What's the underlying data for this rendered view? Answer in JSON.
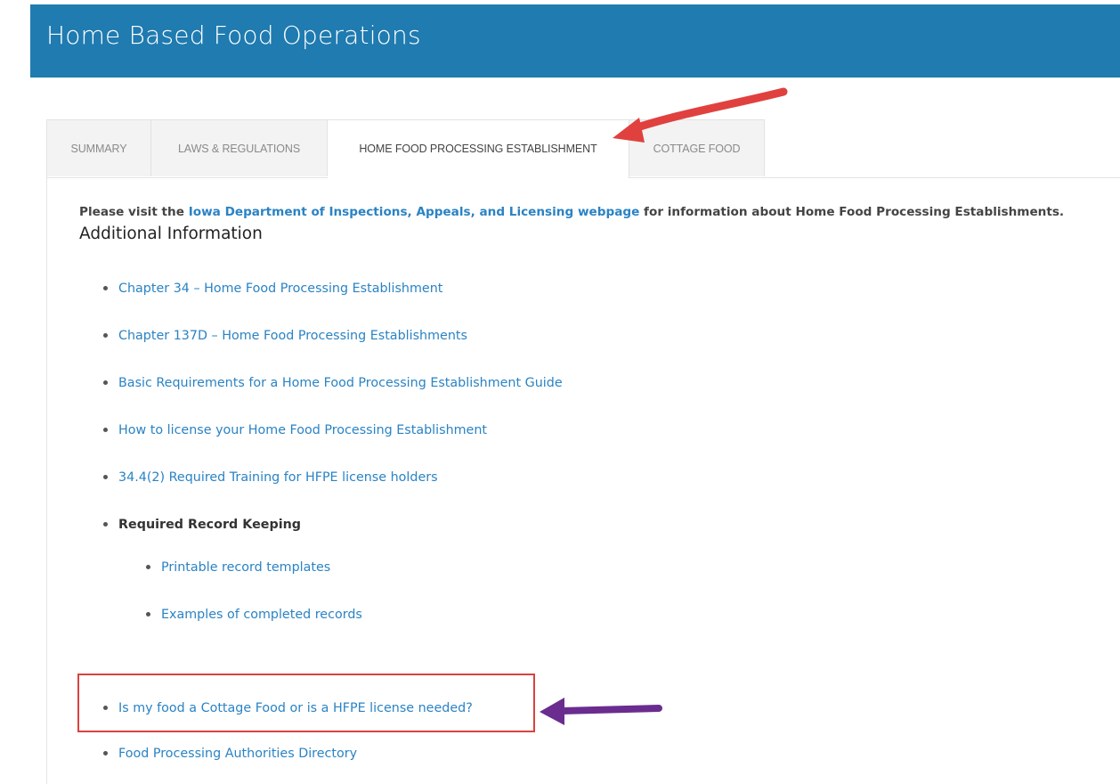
{
  "header": {
    "title": "Home Based Food Operations"
  },
  "tabs": [
    {
      "label": "SUMMARY"
    },
    {
      "label": "LAWS & REGULATIONS"
    },
    {
      "label": "HOME FOOD PROCESSING ESTABLISHMENT"
    },
    {
      "label": "COTTAGE FOOD"
    }
  ],
  "content": {
    "intro_prefix": "Please visit the ",
    "intro_link": "Iowa Department of Inspections, Appeals, and Licensing webpage",
    "intro_suffix": " for information about Home Food Processing Establishments.",
    "section_heading": "Additional Information",
    "links": [
      "Chapter 34 – Home Food Processing Establishment",
      "Chapter 137D – Home Food Processing Establishments",
      "Basic Requirements  for a Home Food Processing Establishment Guide",
      "How to license your Home Food Processing Establishment",
      "34.4(2) Required Training for HFPE license holders"
    ],
    "record_keeping": {
      "label": "Required Record Keeping",
      "sub_links": [
        "Printable record templates",
        "Examples of completed records"
      ]
    },
    "bottom_links": [
      "Is my food a Cottage Food or is a HFPE license needed?",
      "Food Processing Authorities Directory"
    ]
  },
  "colors": {
    "header_bg": "#1f7bb0",
    "link": "#2a83c4",
    "red_arrow": "#e0413f",
    "purple_arrow": "#6a2d8f",
    "highlight_box": "#d9423f"
  }
}
